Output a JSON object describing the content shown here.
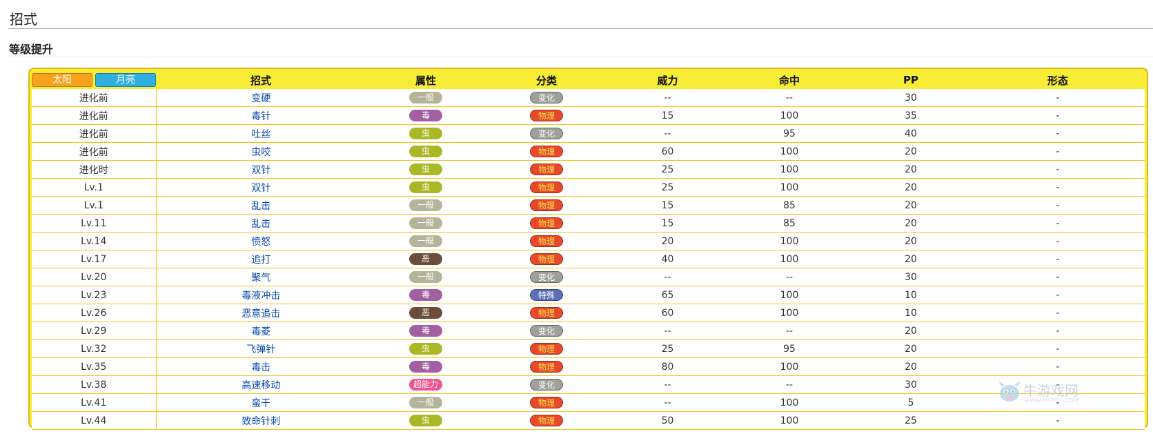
{
  "section_title": "招式",
  "subsection_title": "等级提升",
  "tabs": {
    "sun": "太阳",
    "moon": "月亮"
  },
  "columns": [
    "招式",
    "属性",
    "分类",
    "威力",
    "命中",
    "PP",
    "形态"
  ],
  "type_colors": {
    "一般": "#b5b39a",
    "毒": "#a45fa2",
    "虫": "#a9b824",
    "恶": "#6b4d3a",
    "超能力": "#f2528b"
  },
  "category_colors": {
    "变化": "#a0a09a",
    "物理": "#e8492b",
    "特殊": "#5a70b8"
  },
  "rows": [
    {
      "level": "进化前",
      "move": "变硬",
      "type": "一般",
      "category": "变化",
      "power": "--",
      "accuracy": "--",
      "pp": "30",
      "form": "-"
    },
    {
      "level": "进化前",
      "move": "毒针",
      "type": "毒",
      "category": "物理",
      "power": "15",
      "accuracy": "100",
      "pp": "35",
      "form": "-"
    },
    {
      "level": "进化前",
      "move": "吐丝",
      "type": "虫",
      "category": "变化",
      "power": "--",
      "accuracy": "95",
      "pp": "40",
      "form": "-"
    },
    {
      "level": "进化前",
      "move": "虫咬",
      "type": "虫",
      "category": "物理",
      "power": "60",
      "accuracy": "100",
      "pp": "20",
      "form": "-"
    },
    {
      "level": "进化时",
      "move": "双针",
      "type": "虫",
      "category": "物理",
      "power": "25",
      "accuracy": "100",
      "pp": "20",
      "form": "-"
    },
    {
      "level": "Lv.1",
      "move": "双针",
      "type": "虫",
      "category": "物理",
      "power": "25",
      "accuracy": "100",
      "pp": "20",
      "form": "-"
    },
    {
      "level": "Lv.1",
      "move": "乱击",
      "type": "一般",
      "category": "物理",
      "power": "15",
      "accuracy": "85",
      "pp": "20",
      "form": "-"
    },
    {
      "level": "Lv.11",
      "move": "乱击",
      "type": "一般",
      "category": "物理",
      "power": "15",
      "accuracy": "85",
      "pp": "20",
      "form": "-"
    },
    {
      "level": "Lv.14",
      "move": "愤怒",
      "type": "一般",
      "category": "物理",
      "power": "20",
      "accuracy": "100",
      "pp": "20",
      "form": "-"
    },
    {
      "level": "Lv.17",
      "move": "追打",
      "type": "恶",
      "category": "物理",
      "power": "40",
      "accuracy": "100",
      "pp": "20",
      "form": "-"
    },
    {
      "level": "Lv.20",
      "move": "聚气",
      "type": "一般",
      "category": "变化",
      "power": "--",
      "accuracy": "--",
      "pp": "30",
      "form": "-"
    },
    {
      "level": "Lv.23",
      "move": "毒液冲击",
      "type": "毒",
      "category": "特殊",
      "power": "65",
      "accuracy": "100",
      "pp": "10",
      "form": "-"
    },
    {
      "level": "Lv.26",
      "move": "恶意追击",
      "type": "恶",
      "category": "物理",
      "power": "60",
      "accuracy": "100",
      "pp": "10",
      "form": "-"
    },
    {
      "level": "Lv.29",
      "move": "毒菱",
      "type": "毒",
      "category": "变化",
      "power": "--",
      "accuracy": "--",
      "pp": "20",
      "form": "-"
    },
    {
      "level": "Lv.32",
      "move": "飞弹针",
      "type": "虫",
      "category": "物理",
      "power": "25",
      "accuracy": "95",
      "pp": "20",
      "form": "-"
    },
    {
      "level": "Lv.35",
      "move": "毒击",
      "type": "毒",
      "category": "物理",
      "power": "80",
      "accuracy": "100",
      "pp": "20",
      "form": "-"
    },
    {
      "level": "Lv.38",
      "move": "高速移动",
      "type": "超能力",
      "category": "变化",
      "power": "--",
      "accuracy": "--",
      "pp": "30",
      "form": "-"
    },
    {
      "level": "Lv.41",
      "move": "蛮干",
      "type": "一般",
      "category": "物理",
      "power": "--",
      "accuracy": "100",
      "pp": "5",
      "form": "-"
    },
    {
      "level": "Lv.44",
      "move": "致命针刺",
      "type": "虫",
      "category": "物理",
      "power": "50",
      "accuracy": "100",
      "pp": "25",
      "form": "-"
    }
  ],
  "watermark": {
    "text": "牛游戏网",
    "sub": "WWW.NIUYOU.COM"
  }
}
